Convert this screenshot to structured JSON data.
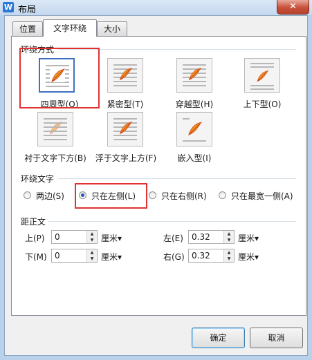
{
  "window": {
    "title": "布局",
    "app_icon_glyph": "W",
    "close_glyph": "✕"
  },
  "tabs": [
    {
      "label": "位置",
      "active": false
    },
    {
      "label": "文字环绕",
      "active": true
    },
    {
      "label": "大小",
      "active": false
    }
  ],
  "wrap_style": {
    "section_label": "环绕方式",
    "options": [
      {
        "label": "四周型(Q)",
        "selected": true
      },
      {
        "label": "紧密型(T)",
        "selected": false
      },
      {
        "label": "穿越型(H)",
        "selected": false
      },
      {
        "label": "上下型(O)",
        "selected": false
      },
      {
        "label": "衬于文字下方(B)",
        "selected": false
      },
      {
        "label": "浮于文字上方(F)",
        "selected": false
      },
      {
        "label": "嵌入型(I)",
        "selected": false
      }
    ]
  },
  "wrap_text": {
    "section_label": "环绕文字",
    "options": [
      {
        "label": "两边(S)",
        "checked": false
      },
      {
        "label": "只在左侧(L)",
        "checked": true
      },
      {
        "label": "只在右侧(R)",
        "checked": false
      },
      {
        "label": "只在最宽一侧(A)",
        "checked": false
      }
    ]
  },
  "distance": {
    "section_label": "距正文",
    "top": {
      "label": "上(P)",
      "value": "0",
      "unit": "厘米▾"
    },
    "bottom": {
      "label": "下(M)",
      "value": "0",
      "unit": "厘米▾"
    },
    "left": {
      "label": "左(E)",
      "value": "0.32",
      "unit": "厘米▾"
    },
    "right": {
      "label": "右(G)",
      "value": "0.32",
      "unit": "厘米▾"
    }
  },
  "buttons": {
    "ok": "确定",
    "cancel": "取消"
  },
  "icons": {
    "spin_up": "▲",
    "spin_down": "▼"
  },
  "colors": {
    "annotation": "#e23131",
    "selected_border": "#3f70c0",
    "radio_dot": "#1c57b8"
  }
}
